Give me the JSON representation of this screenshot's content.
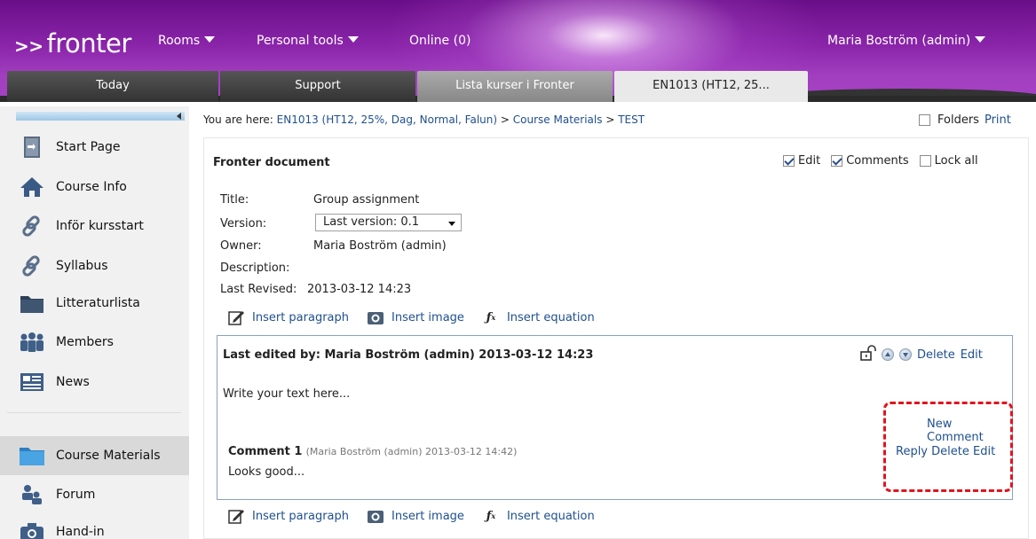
{
  "header": {
    "logo_arrows": ">>",
    "logo_text": "fronter",
    "menu": [
      {
        "label": "Rooms",
        "has_caret": true
      },
      {
        "label": "Personal tools",
        "has_caret": true
      },
      {
        "label": "Online (0)",
        "has_caret": false
      }
    ],
    "user_label": "Maria Boström (admin)"
  },
  "tabs": [
    {
      "label": "Today"
    },
    {
      "label": "Support"
    },
    {
      "label": "Lista kurser i Fronter"
    },
    {
      "label": "EN1013 (HT12, 25..."
    }
  ],
  "sidebar": {
    "items": [
      {
        "label": "Start Page",
        "icon": "door-icon"
      },
      {
        "label": "Course Info",
        "icon": "home-icon"
      },
      {
        "label": "Inför kursstart",
        "icon": "link-icon"
      },
      {
        "label": "Syllabus",
        "icon": "link-icon"
      },
      {
        "label": "Litteraturlista",
        "icon": "folder-icon"
      },
      {
        "label": "Members",
        "icon": "people-icon"
      },
      {
        "label": "News",
        "icon": "news-icon"
      },
      {
        "label": "Course Materials",
        "icon": "folder-icon",
        "selected": true
      },
      {
        "label": "Forum",
        "icon": "forum-icon"
      },
      {
        "label": "Hand-in",
        "icon": "camera-icon"
      }
    ]
  },
  "breadcrumb": {
    "prefix": "You are here:",
    "items": [
      "EN1013 (HT12, 25%, Dag, Normal, Falun)",
      "Course Materials",
      "TEST"
    ],
    "separator": ">"
  },
  "top_options": {
    "folders_label": "Folders",
    "print_label": "Print"
  },
  "document": {
    "title": "Fronter document",
    "options": {
      "edit_label": "Edit",
      "comments_label": "Comments",
      "lock_all_label": "Lock all"
    },
    "meta": {
      "title_key": "Title:",
      "title_value": "Group assignment",
      "version_key": "Version:",
      "version_value": "Last version: 0.1",
      "owner_key": "Owner:",
      "owner_value": "Maria Boström (admin)",
      "description_key": "Description:",
      "revised_key": "Last Revised:",
      "revised_value": "2013-03-12 14:23"
    },
    "insert": {
      "paragraph": "Insert paragraph",
      "image": "Insert image",
      "equation": "Insert equation"
    },
    "block": {
      "heading": "Last edited by: Maria Boström (admin) 2013-03-12 14:23",
      "delete_label": "Delete",
      "edit_label": "Edit",
      "text": "Write your text here...",
      "new_comment": "New Comment",
      "comment": {
        "title": "Comment 1",
        "meta": "(Maria Boström (admin) 2013-03-12 14:42)",
        "text": "Looks good...",
        "reply": "Reply",
        "delete": "Delete",
        "edit": "Edit"
      }
    }
  },
  "colors": {
    "accent_purple": "#8a25aa",
    "link_blue": "#1f4f8f",
    "highlight_red": "#e0141e"
  }
}
